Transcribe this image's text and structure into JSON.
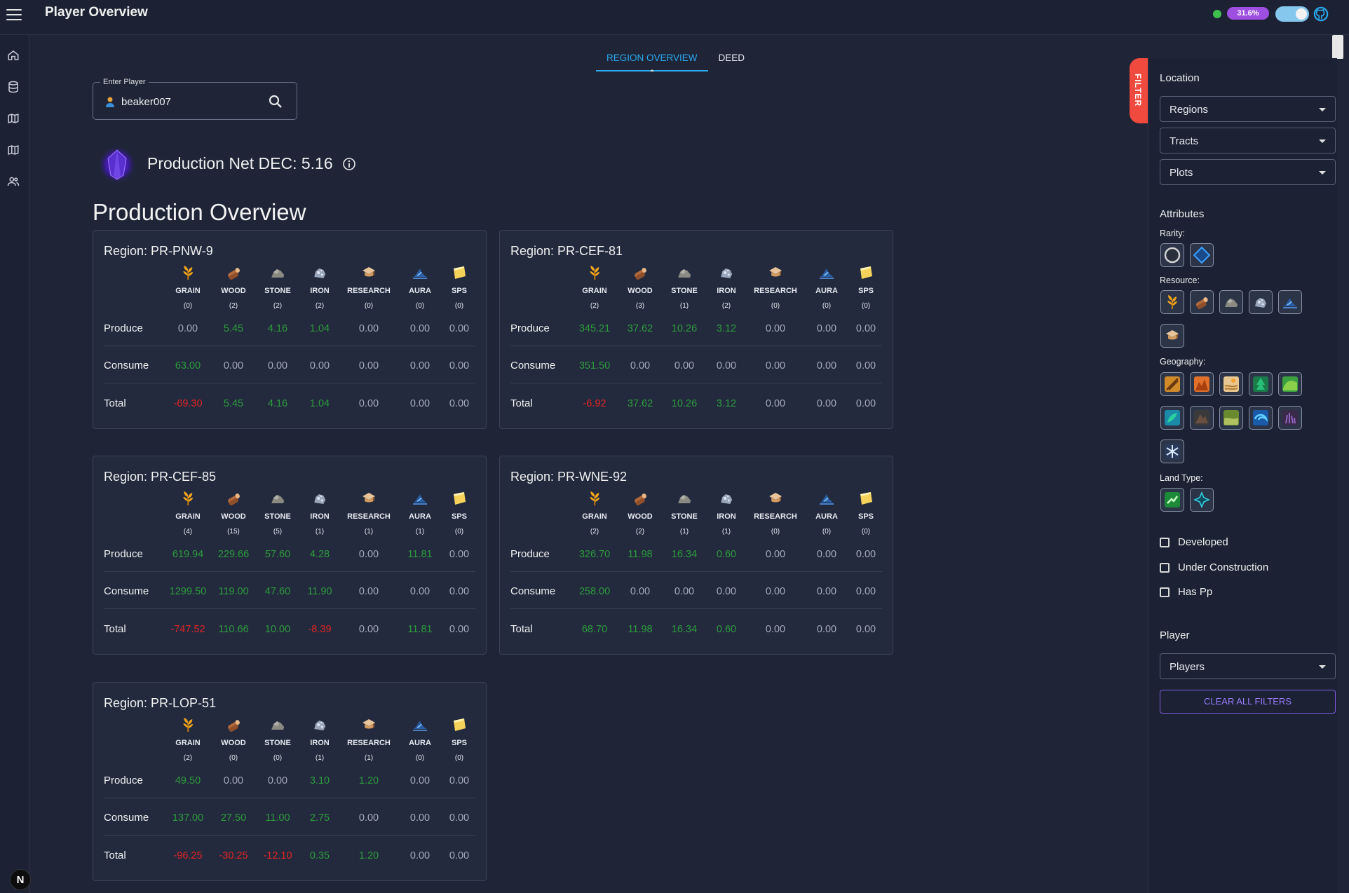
{
  "app": {
    "title": "Player Overview",
    "percent_badge": "31.6%"
  },
  "tabs": [
    {
      "label": "REGION OVERVIEW",
      "active": true
    },
    {
      "label": "DEED",
      "active": false
    }
  ],
  "player_input": {
    "legend": "Enter Player",
    "value": "beaker007"
  },
  "production_net": {
    "text": "Production Net DEC: 5.16"
  },
  "section_title": "Production Overview",
  "row_labels": {
    "produce": "Produce",
    "consume": "Consume",
    "total": "Total"
  },
  "resources": [
    "GRAIN",
    "WOOD",
    "STONE",
    "IRON",
    "RESEARCH",
    "AURA",
    "SPS"
  ],
  "regions": [
    {
      "title": "Region: PR-PNW-9",
      "counts": [
        "(0)",
        "(2)",
        "(2)",
        "(2)",
        "(0)",
        "(0)",
        "(0)"
      ],
      "produce": [
        "0.00",
        "5.45",
        "4.16",
        "1.04",
        "0.00",
        "0.00",
        "0.00"
      ],
      "consume": [
        "63.00",
        "0.00",
        "0.00",
        "0.00",
        "0.00",
        "0.00",
        "0.00"
      ],
      "total": [
        "-69.30",
        "5.45",
        "4.16",
        "1.04",
        "0.00",
        "0.00",
        "0.00"
      ]
    },
    {
      "title": "Region: PR-CEF-81",
      "counts": [
        "(2)",
        "(3)",
        "(1)",
        "(2)",
        "(0)",
        "(0)",
        "(0)"
      ],
      "produce": [
        "345.21",
        "37.62",
        "10.26",
        "3.12",
        "0.00",
        "0.00",
        "0.00"
      ],
      "consume": [
        "351.50",
        "0.00",
        "0.00",
        "0.00",
        "0.00",
        "0.00",
        "0.00"
      ],
      "total": [
        "-6.92",
        "37.62",
        "10.26",
        "3.12",
        "0.00",
        "0.00",
        "0.00"
      ]
    },
    {
      "title": "Region: PR-CEF-85",
      "counts": [
        "(4)",
        "(15)",
        "(5)",
        "(1)",
        "(1)",
        "(1)",
        "(0)"
      ],
      "produce": [
        "619.94",
        "229.66",
        "57.60",
        "4.28",
        "0.00",
        "11.81",
        "0.00"
      ],
      "consume": [
        "1299.50",
        "119.00",
        "47.60",
        "11.90",
        "0.00",
        "0.00",
        "0.00"
      ],
      "total": [
        "-747.52",
        "110.66",
        "10.00",
        "-8.39",
        "0.00",
        "11.81",
        "0.00"
      ]
    },
    {
      "title": "Region: PR-WNE-92",
      "counts": [
        "(2)",
        "(2)",
        "(1)",
        "(1)",
        "(0)",
        "(0)",
        "(0)"
      ],
      "produce": [
        "326.70",
        "11.98",
        "16.34",
        "0.60",
        "0.00",
        "0.00",
        "0.00"
      ],
      "consume": [
        "258.00",
        "0.00",
        "0.00",
        "0.00",
        "0.00",
        "0.00",
        "0.00"
      ],
      "total": [
        "68.70",
        "11.98",
        "16.34",
        "0.60",
        "0.00",
        "0.00",
        "0.00"
      ]
    },
    {
      "title": "Region: PR-LOP-51",
      "counts": [
        "(2)",
        "(0)",
        "(0)",
        "(1)",
        "(1)",
        "(0)",
        "(0)"
      ],
      "produce": [
        "49.50",
        "0.00",
        "0.00",
        "3.10",
        "1.20",
        "0.00",
        "0.00"
      ],
      "consume": [
        "137.00",
        "27.50",
        "11.00",
        "2.75",
        "0.00",
        "0.00",
        "0.00"
      ],
      "total": [
        "-96.25",
        "-30.25",
        "-12.10",
        "0.35",
        "1.20",
        "0.00",
        "0.00"
      ]
    }
  ],
  "filter": {
    "tab_label": "FILTER",
    "location_heading": "Location",
    "location_dropdowns": [
      "Regions",
      "Tracts",
      "Plots"
    ],
    "attributes_heading": "Attributes",
    "rarity_label": "Rarity:",
    "resource_label": "Resource:",
    "geography_label": "Geography:",
    "land_type_label": "Land Type:",
    "checkboxes": [
      "Developed",
      "Under Construction",
      "Has Pp"
    ],
    "player_heading": "Player",
    "player_dropdown": "Players",
    "clear_button": "CLEAR ALL FILTERS"
  },
  "icons": {
    "resources": [
      "grain-icon",
      "wood-icon",
      "stone-icon",
      "iron-icon",
      "research-icon",
      "aura-icon",
      "sps-icon"
    ],
    "geography": [
      "badlands-icon",
      "canyon-icon",
      "desert-icon",
      "forest-icon",
      "hills-icon",
      "jungle-icon",
      "mountain-icon",
      "plains-icon",
      "water-icon",
      "swamp-icon",
      "tundra-icon"
    ]
  },
  "colors": {
    "positive": "#2c9c3c",
    "negative": "#e02424",
    "accent": "#2ba8ee",
    "filter_tab": "#f04a3e"
  }
}
